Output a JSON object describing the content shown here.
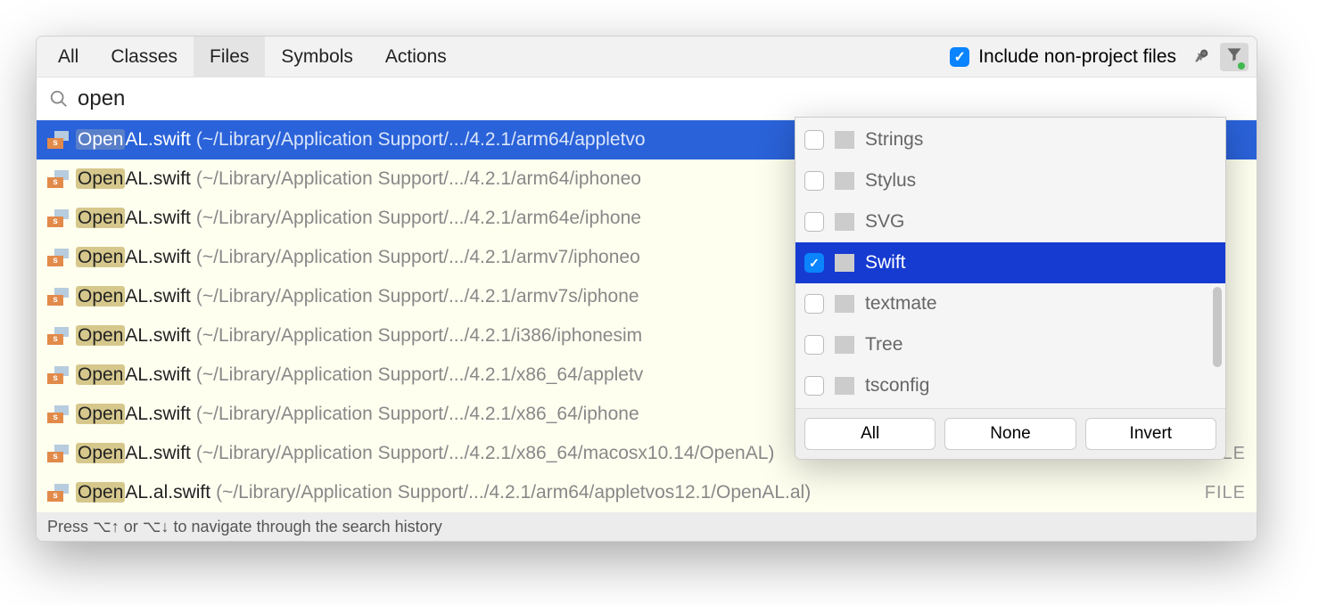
{
  "tabs": [
    "All",
    "Classes",
    "Files",
    "Symbols",
    "Actions"
  ],
  "active_tab_index": 2,
  "include_label": "Include non-project files",
  "include_checked": true,
  "search_value": "open",
  "results": [
    {
      "match": "Open",
      "rest": "AL.swift",
      "path": "(~/Library/Application Support/.../4.2.1/arm64/appletvo",
      "badge": "",
      "selected": true,
      "truncated": true
    },
    {
      "match": "Open",
      "rest": "AL.swift",
      "path": "(~/Library/Application Support/.../4.2.1/arm64/iphoneo",
      "badge": "",
      "truncated": true
    },
    {
      "match": "Open",
      "rest": "AL.swift",
      "path": "(~/Library/Application Support/.../4.2.1/arm64e/iphone",
      "badge": "",
      "truncated": true
    },
    {
      "match": "Open",
      "rest": "AL.swift",
      "path": "(~/Library/Application Support/.../4.2.1/armv7/iphoneo",
      "badge": "",
      "truncated": true
    },
    {
      "match": "Open",
      "rest": "AL.swift",
      "path": "(~/Library/Application Support/.../4.2.1/armv7s/iphone",
      "badge": "",
      "truncated": true
    },
    {
      "match": "Open",
      "rest": "AL.swift",
      "path": "(~/Library/Application Support/.../4.2.1/i386/iphonesim",
      "badge": "",
      "truncated": true
    },
    {
      "match": "Open",
      "rest": "AL.swift",
      "path": "(~/Library/Application Support/.../4.2.1/x86_64/appletv",
      "badge": "",
      "truncated": true
    },
    {
      "match": "Open",
      "rest": "AL.swift",
      "path": "(~/Library/Application Support/.../4.2.1/x86_64/iphone",
      "badge": "",
      "truncated": true
    },
    {
      "match": "Open",
      "rest": "AL.swift",
      "path": "(~/Library/Application Support/.../4.2.1/x86_64/macosx10.14/OpenAL)",
      "badge": "FILE"
    },
    {
      "match": "Open",
      "rest": "AL.al.swift",
      "path": "(~/Library/Application Support/.../4.2.1/arm64/appletvos12.1/OpenAL.al)",
      "badge": "FILE"
    }
  ],
  "status_text": "Press ⌥↑ or ⌥↓ to navigate through the search history",
  "filter_popup": {
    "items": [
      {
        "label": "Strings",
        "checked": false,
        "cls": "ft-strings"
      },
      {
        "label": "Stylus",
        "checked": false,
        "cls": "ft-stylus"
      },
      {
        "label": "SVG",
        "checked": false,
        "cls": "ft-svg"
      },
      {
        "label": "Swift",
        "checked": true,
        "cls": "ft-swift"
      },
      {
        "label": "textmate",
        "checked": false,
        "cls": "ft-textmate"
      },
      {
        "label": "Tree",
        "checked": false,
        "cls": "ft-tree"
      },
      {
        "label": "tsconfig",
        "checked": false,
        "cls": "ft-tsconfig"
      }
    ],
    "buttons": [
      "All",
      "None",
      "Invert"
    ]
  }
}
